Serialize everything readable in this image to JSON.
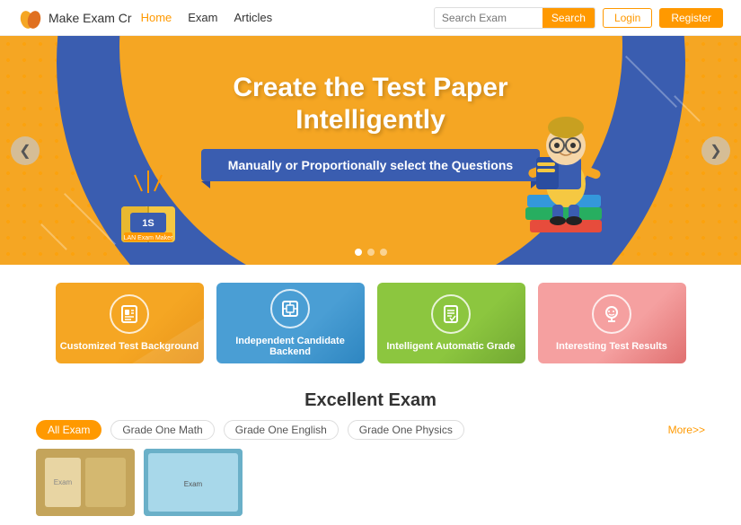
{
  "header": {
    "logo_text": "Make Exam Cr",
    "nav_items": [
      {
        "label": "Home",
        "active": true
      },
      {
        "label": "Exam",
        "active": false
      },
      {
        "label": "Articles",
        "active": false
      }
    ],
    "search_placeholder": "Search Exam",
    "search_button": "Search",
    "login_button": "Login",
    "register_button": "Register"
  },
  "hero": {
    "title_line1": "Create the Test Paper",
    "title_line2": "Intelligently",
    "subtitle": "Manually or Proportionally select the Questions",
    "arrow_left": "❮",
    "arrow_right": "❯"
  },
  "features": [
    {
      "label": "Customized Test Background",
      "icon": "📋",
      "color": "card-yellow"
    },
    {
      "label": "Independent Candidate Backend",
      "icon": "📦",
      "color": "card-blue"
    },
    {
      "label": "Intelligent Automatic Grade",
      "icon": "📄",
      "color": "card-green"
    },
    {
      "label": "Interesting Test Results",
      "icon": "🧠",
      "color": "card-pink"
    }
  ],
  "excellent_exam": {
    "title": "Excellent Exam",
    "tabs": [
      {
        "label": "All Exam",
        "active": true
      },
      {
        "label": "Grade One Math",
        "active": false
      },
      {
        "label": "Grade One English",
        "active": false
      },
      {
        "label": "Grade One Physics",
        "active": false
      }
    ],
    "more_link": "More>>"
  }
}
